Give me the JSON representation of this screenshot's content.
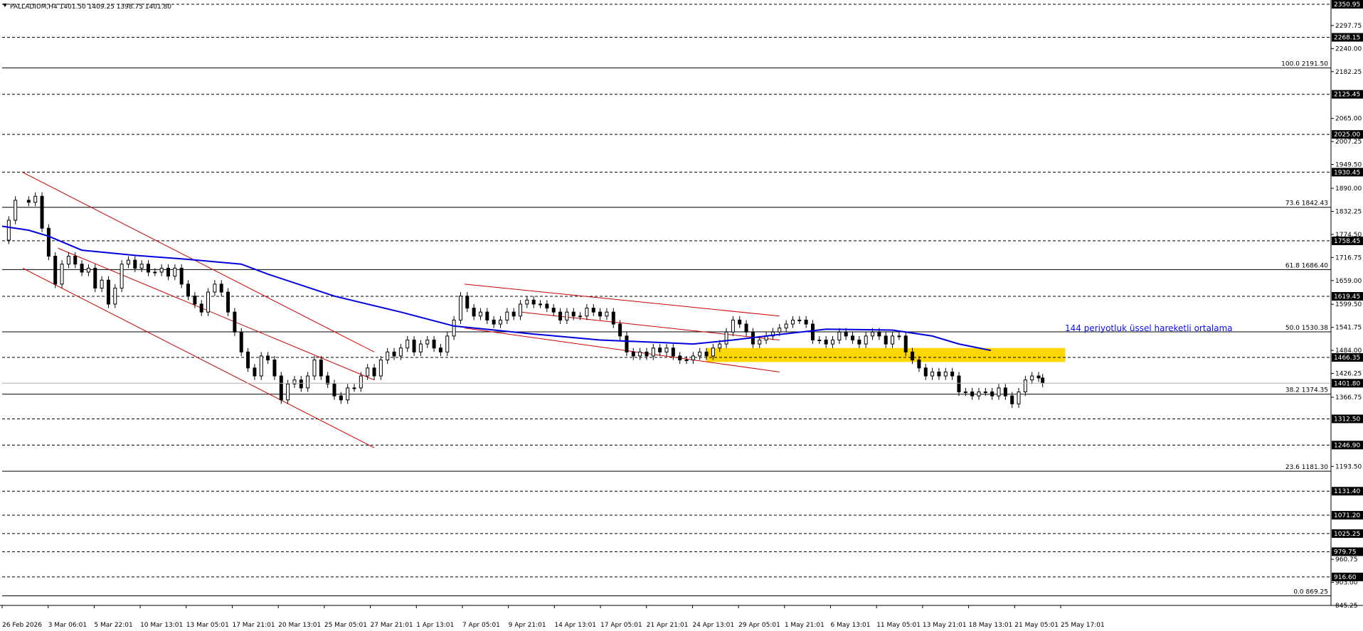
{
  "header": {
    "symbol_text": "PALLADIUM,H4  1401.50 1409.25 1398.75 1401.80"
  },
  "annotations": {
    "ema_label": "144 periyotluk üssel hareketli ortalama"
  },
  "colors": {
    "background": "#ffffff",
    "candles": "#000000",
    "ema": "#0000dd",
    "channels": "#cc0000",
    "zone": "#ffd700",
    "level_lines": "#000000"
  },
  "chart_data": {
    "type": "candlestick",
    "symbol": "PALLADIUM",
    "timeframe": "H4",
    "ohlc_last": {
      "open": 1401.5,
      "high": 1409.25,
      "low": 1398.75,
      "close": 1401.8
    },
    "ylim": [
      845.25,
      2350.95
    ],
    "y_ticks": [
      "2297.75",
      "2240.00",
      "2182.25",
      "2065.00",
      "2007.25",
      "1949.50",
      "1890.00",
      "1832.25",
      "1774.50",
      "1716.75",
      "1659.00",
      "1599.50",
      "1541.75",
      "1484.00",
      "1426.25",
      "1366.75",
      "1193.50",
      "960.75",
      "903.00",
      "845.25"
    ],
    "current_price": "1401.80",
    "x_ticks": [
      "26 Feb 2026",
      "3 Mar 06:01",
      "5 Mar 22:01",
      "10 Mar 13:01",
      "13 Mar 05:01",
      "17 Mar 21:01",
      "20 Mar 13:01",
      "25 Mar 05:01",
      "27 Mar 21:01",
      "1 Apr 13:01",
      "7 Apr 05:01",
      "9 Apr 21:01",
      "14 Apr 13:01",
      "17 Apr 05:01",
      "21 Apr 21:01",
      "24 Apr 13:01",
      "29 Apr 05:01",
      "1 May 21:01",
      "6 May 13:01",
      "11 May 05:01",
      "13 May 21:01",
      "18 May 13:01",
      "21 May 05:01",
      "25 May 17:01"
    ],
    "horizontal_levels": [
      {
        "price": 2350.95,
        "label": "2350.95",
        "style": "dashed"
      },
      {
        "price": 2268.15,
        "label": "2268.15",
        "style": "dashed"
      },
      {
        "price": 2125.45,
        "label": "2125.45",
        "style": "dashed"
      },
      {
        "price": 2025.0,
        "label": "2025.00",
        "style": "dashed"
      },
      {
        "price": 1930.45,
        "label": "1930.45",
        "style": "dashed"
      },
      {
        "price": 1758.45,
        "label": "1758.45",
        "style": "dashed"
      },
      {
        "price": 1619.45,
        "label": "1619.45",
        "style": "dashed"
      },
      {
        "price": 1466.35,
        "label": "1466.35",
        "style": "dashed"
      },
      {
        "price": 1312.5,
        "label": "1312.50",
        "style": "dashed"
      },
      {
        "price": 1246.9,
        "label": "1246.90",
        "style": "dashed"
      },
      {
        "price": 1131.4,
        "label": "1131.40",
        "style": "dashed"
      },
      {
        "price": 1071.2,
        "label": "1071.20",
        "style": "dashed"
      },
      {
        "price": 1025.25,
        "label": "1025.25",
        "style": "dashed"
      },
      {
        "price": 979.75,
        "label": "979.75",
        "style": "dashed"
      },
      {
        "price": 916.6,
        "label": "916.60",
        "style": "dashed"
      }
    ],
    "fibonacci": [
      {
        "label": "100.0 2191.50",
        "price": 2191.5
      },
      {
        "label": "73.6 1842.43",
        "price": 1842.43
      },
      {
        "label": "61.8 1686.40",
        "price": 1686.4
      },
      {
        "label": "50.0 1530.38",
        "price": 1530.38
      },
      {
        "label": "38.2 1374.35",
        "price": 1374.35
      },
      {
        "label": "23.6 1181.30",
        "price": 1181.3
      },
      {
        "label": "0.0 869.25",
        "price": 869.25
      }
    ],
    "zone": {
      "price_low": 1455,
      "price_high": 1490
    },
    "ema_series": [
      [
        0,
        1795
      ],
      [
        0.02,
        1785
      ],
      [
        0.035,
        1770
      ],
      [
        0.06,
        1735
      ],
      [
        0.1,
        1722
      ],
      [
        0.14,
        1712
      ],
      [
        0.18,
        1700
      ],
      [
        0.2,
        1675
      ],
      [
        0.25,
        1620
      ],
      [
        0.3,
        1580
      ],
      [
        0.34,
        1545
      ],
      [
        0.4,
        1525
      ],
      [
        0.45,
        1510
      ],
      [
        0.5,
        1503
      ],
      [
        0.52,
        1500
      ],
      [
        0.55,
        1510
      ],
      [
        0.58,
        1522
      ],
      [
        0.62,
        1537
      ],
      [
        0.67,
        1535
      ],
      [
        0.7,
        1520
      ],
      [
        0.72,
        1500
      ],
      [
        0.744,
        1484
      ]
    ],
    "price_series": [
      [
        0,
        1760
      ],
      [
        0.005,
        1810
      ],
      [
        0.01,
        1860
      ],
      [
        0.02,
        1855
      ],
      [
        0.025,
        1870
      ],
      [
        0.03,
        1790
      ],
      [
        0.035,
        1720
      ],
      [
        0.04,
        1650
      ],
      [
        0.045,
        1700
      ],
      [
        0.05,
        1720
      ],
      [
        0.055,
        1700
      ],
      [
        0.06,
        1680
      ],
      [
        0.065,
        1690
      ],
      [
        0.07,
        1640
      ],
      [
        0.075,
        1660
      ],
      [
        0.08,
        1600
      ],
      [
        0.085,
        1640
      ],
      [
        0.09,
        1700
      ],
      [
        0.095,
        1710
      ],
      [
        0.1,
        1690
      ],
      [
        0.105,
        1700
      ],
      [
        0.11,
        1680
      ],
      [
        0.115,
        1680
      ],
      [
        0.12,
        1690
      ],
      [
        0.125,
        1670
      ],
      [
        0.13,
        1690
      ],
      [
        0.135,
        1650
      ],
      [
        0.14,
        1620
      ],
      [
        0.145,
        1600
      ],
      [
        0.15,
        1580
      ],
      [
        0.155,
        1630
      ],
      [
        0.16,
        1650
      ],
      [
        0.165,
        1630
      ],
      [
        0.17,
        1580
      ],
      [
        0.175,
        1530
      ],
      [
        0.18,
        1480
      ],
      [
        0.185,
        1440
      ],
      [
        0.19,
        1420
      ],
      [
        0.195,
        1470
      ],
      [
        0.2,
        1460
      ],
      [
        0.205,
        1420
      ],
      [
        0.21,
        1360
      ],
      [
        0.215,
        1400
      ],
      [
        0.22,
        1410
      ],
      [
        0.225,
        1390
      ],
      [
        0.23,
        1420
      ],
      [
        0.235,
        1460
      ],
      [
        0.24,
        1420
      ],
      [
        0.245,
        1400
      ],
      [
        0.25,
        1370
      ],
      [
        0.255,
        1360
      ],
      [
        0.26,
        1390
      ],
      [
        0.265,
        1390
      ],
      [
        0.27,
        1420
      ],
      [
        0.275,
        1440
      ],
      [
        0.28,
        1420
      ],
      [
        0.285,
        1460
      ],
      [
        0.29,
        1480
      ],
      [
        0.295,
        1470
      ],
      [
        0.3,
        1490
      ],
      [
        0.305,
        1510
      ],
      [
        0.31,
        1480
      ],
      [
        0.315,
        1500
      ],
      [
        0.32,
        1510
      ],
      [
        0.325,
        1490
      ],
      [
        0.33,
        1480
      ],
      [
        0.335,
        1520
      ],
      [
        0.34,
        1560
      ],
      [
        0.345,
        1620
      ],
      [
        0.35,
        1590
      ],
      [
        0.355,
        1570
      ],
      [
        0.36,
        1580
      ],
      [
        0.365,
        1560
      ],
      [
        0.37,
        1550
      ],
      [
        0.375,
        1560
      ],
      [
        0.38,
        1580
      ],
      [
        0.385,
        1570
      ],
      [
        0.39,
        1600
      ],
      [
        0.395,
        1610
      ],
      [
        0.4,
        1600
      ],
      [
        0.405,
        1600
      ],
      [
        0.41,
        1590
      ],
      [
        0.415,
        1580
      ],
      [
        0.42,
        1560
      ],
      [
        0.425,
        1580
      ],
      [
        0.43,
        1570
      ],
      [
        0.435,
        1570
      ],
      [
        0.44,
        1590
      ],
      [
        0.445,
        1580
      ],
      [
        0.45,
        1570
      ],
      [
        0.455,
        1580
      ],
      [
        0.46,
        1550
      ],
      [
        0.465,
        1520
      ],
      [
        0.47,
        1480
      ],
      [
        0.475,
        1470
      ],
      [
        0.48,
        1480
      ],
      [
        0.485,
        1470
      ],
      [
        0.49,
        1490
      ],
      [
        0.495,
        1480
      ],
      [
        0.5,
        1490
      ],
      [
        0.505,
        1470
      ],
      [
        0.51,
        1460
      ],
      [
        0.515,
        1460
      ],
      [
        0.52,
        1470
      ],
      [
        0.525,
        1480
      ],
      [
        0.53,
        1470
      ],
      [
        0.535,
        1490
      ],
      [
        0.54,
        1500
      ],
      [
        0.545,
        1530
      ],
      [
        0.55,
        1560
      ],
      [
        0.555,
        1550
      ],
      [
        0.56,
        1530
      ],
      [
        0.565,
        1500
      ],
      [
        0.57,
        1510
      ],
      [
        0.575,
        1520
      ],
      [
        0.58,
        1530
      ],
      [
        0.585,
        1540
      ],
      [
        0.59,
        1550
      ],
      [
        0.595,
        1560
      ],
      [
        0.6,
        1560
      ],
      [
        0.605,
        1550
      ],
      [
        0.61,
        1510
      ],
      [
        0.615,
        1510
      ],
      [
        0.62,
        1500
      ],
      [
        0.625,
        1510
      ],
      [
        0.63,
        1530
      ],
      [
        0.635,
        1520
      ],
      [
        0.64,
        1510
      ],
      [
        0.645,
        1500
      ],
      [
        0.65,
        1520
      ],
      [
        0.655,
        1530
      ],
      [
        0.66,
        1520
      ],
      [
        0.665,
        1500
      ],
      [
        0.67,
        1520
      ],
      [
        0.675,
        1520
      ],
      [
        0.68,
        1480
      ],
      [
        0.685,
        1460
      ],
      [
        0.69,
        1440
      ],
      [
        0.695,
        1420
      ],
      [
        0.7,
        1430
      ],
      [
        0.705,
        1420
      ],
      [
        0.71,
        1430
      ],
      [
        0.715,
        1420
      ],
      [
        0.72,
        1380
      ],
      [
        0.725,
        1380
      ],
      [
        0.73,
        1370
      ],
      [
        0.735,
        1380
      ],
      [
        0.74,
        1380
      ],
      [
        0.745,
        1370
      ],
      [
        0.75,
        1390
      ],
      [
        0.755,
        1370
      ],
      [
        0.76,
        1350
      ],
      [
        0.765,
        1380
      ],
      [
        0.77,
        1410
      ],
      [
        0.775,
        1420
      ],
      [
        0.78,
        1415
      ],
      [
        0.783,
        1402
      ]
    ],
    "channels": [
      {
        "x1": 0.0155,
        "p1": 1930,
        "x2": 0.28,
        "p2": 1480
      },
      {
        "x1": 0.0155,
        "p1": 1690,
        "x2": 0.28,
        "p2": 1240
      },
      {
        "x1": 0.042,
        "p1": 1740,
        "x2": 0.28,
        "p2": 1410
      },
      {
        "x1": 0.348,
        "p1": 1650,
        "x2": 0.585,
        "p2": 1570
      },
      {
        "x1": 0.348,
        "p1": 1540,
        "x2": 0.585,
        "p2": 1430
      },
      {
        "x1": 0.39,
        "p1": 1580,
        "x2": 0.585,
        "p2": 1510
      }
    ]
  }
}
